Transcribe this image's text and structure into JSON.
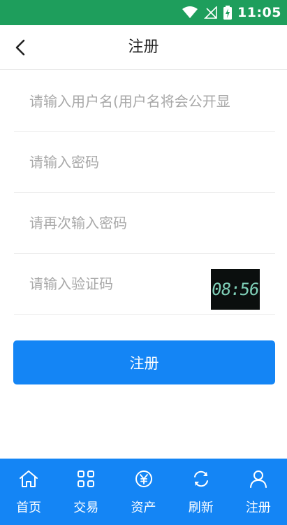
{
  "status_bar": {
    "time": "11:05"
  },
  "header": {
    "title": "注册"
  },
  "form": {
    "username_placeholder": "请输入用户名(用户名将会公开显",
    "password_placeholder": "请输入密码",
    "confirm_placeholder": "请再次输入密码",
    "captcha_placeholder": "请输入验证码",
    "captcha_text": "08:56"
  },
  "submit_label": "注册",
  "tabs": [
    {
      "label": "首页",
      "icon": "home-icon"
    },
    {
      "label": "交易",
      "icon": "grid-icon"
    },
    {
      "label": "资产",
      "icon": "yen-coin-icon"
    },
    {
      "label": "刷新",
      "icon": "refresh-icon"
    },
    {
      "label": "注册",
      "icon": "user-icon"
    }
  ],
  "colors": {
    "status_bar": "#1e9e5c",
    "accent": "#1485f5"
  }
}
